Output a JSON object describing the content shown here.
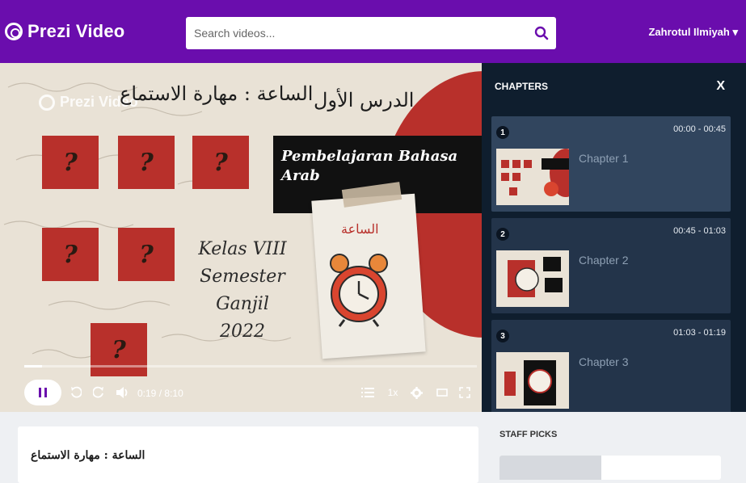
{
  "header": {
    "brand": "Prezi Video",
    "search_placeholder": "Search videos...",
    "user_name": "Zahrotul Ilmiyah ▾"
  },
  "video": {
    "watermark": "Prezi Video",
    "heading_right": "الدرس الأول",
    "heading_left": "الساعة : مهارة الاستماع",
    "banner": "Pembelajaran Bahasa Arab",
    "kelas_lines": [
      "Kelas VIII",
      "Semester Ganjil",
      "2022"
    ],
    "clock_label": "الساعة",
    "question_mark": "?",
    "progress": 0.039,
    "current_time": "0:19",
    "duration": "8:10",
    "time_separator": "/",
    "speed": "1x"
  },
  "chapters": {
    "title": "CHAPTERS",
    "close": "X",
    "items": [
      {
        "number": "1",
        "range": "00:00 - 00:45",
        "label": "Chapter 1"
      },
      {
        "number": "2",
        "range": "00:45 - 01:03",
        "label": "Chapter 2"
      },
      {
        "number": "3",
        "range": "01:03 - 01:19",
        "label": "Chapter 3"
      }
    ]
  },
  "info": {
    "title": "الساعة : مهارة الاستماع"
  },
  "staff_picks": {
    "title": "STAFF PICKS"
  },
  "colors": {
    "header": "#6a0dad",
    "accent_red": "#b8302b",
    "panel": "#0f1e2e",
    "search_icon": "#6a0dad"
  }
}
